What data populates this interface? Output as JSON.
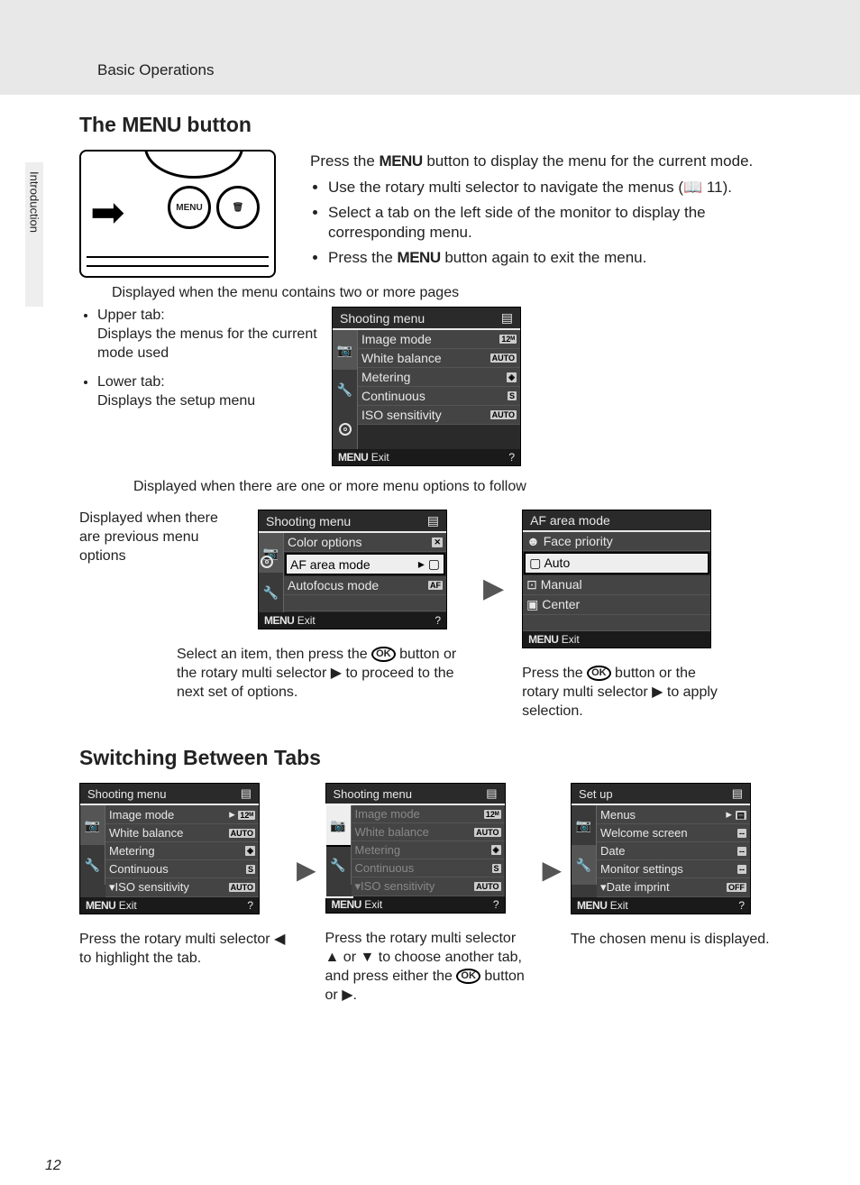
{
  "chapter": "Basic Operations",
  "side_tab": "Introduction",
  "page_number": "12",
  "h1_a": "The ",
  "h1_b": " button",
  "menu_word": "MENU",
  "camera": {
    "btn": "MENU",
    "trash": "🗑"
  },
  "intro": {
    "p1a": "Press the ",
    "p1b": " button to display the menu for the current mode.",
    "b1a": "Use the rotary multi selector to navigate the menus (",
    "b1_ref": "📖 11",
    "b1b": ").",
    "b2": "Select a tab on the left side of the monitor to display the corresponding menu.",
    "b3a": "Press the ",
    "b3b": " button again to exit the menu."
  },
  "note_above": "Displayed when the menu contains two or more pages",
  "tab_desc": {
    "u1": "Upper tab:",
    "u2": "Displays the menus for the current mode used",
    "l1": "Lower tab:",
    "l2": "Displays the setup menu"
  },
  "menu1": {
    "title": "Shooting menu",
    "items": [
      "Image mode",
      "White balance",
      "Metering",
      "Continuous",
      "ISO sensitivity"
    ],
    "exit": "Exit",
    "menu_label": "MENU",
    "pills": [
      "12ᴹ",
      "AUTO",
      "◈",
      "S",
      "AUTO"
    ]
  },
  "note_below": "Displayed when there are one or more menu options to follow",
  "col_a": "Displayed when there are previous menu options",
  "menu2": {
    "title": "Shooting menu",
    "items": [
      "Color options",
      "AF area mode",
      "Autofocus mode"
    ],
    "exit": "Exit",
    "menu_label": "MENU"
  },
  "cap2a": "Select an item, then press the ",
  "cap2b": " button or the rotary multi selector ▶ to proceed to the next set of options.",
  "menu3": {
    "title": "AF area mode",
    "items": [
      "Face priority",
      "Auto",
      "Manual",
      "Center"
    ],
    "exit": "Exit",
    "menu_label": "MENU"
  },
  "cap3a": "Press the ",
  "cap3b": " button or the rotary multi selector ▶ to apply selection.",
  "ok_label": "OK",
  "h2": "Switching Between Tabs",
  "sw1": {
    "title": "Shooting menu",
    "items": [
      "Image mode",
      "White balance",
      "Metering",
      "Continuous",
      "ISO sensitivity"
    ],
    "exit": "Exit",
    "menu_label": "MENU",
    "cap": "Press the rotary multi selector ◀ to highlight the tab."
  },
  "sw2": {
    "title": "Shooting menu",
    "items": [
      "Image mode",
      "White balance",
      "Metering",
      "Continuous",
      "ISO sensitivity"
    ],
    "exit": "Exit",
    "menu_label": "MENU",
    "cap_a": "Press the rotary multi selector ▲ or ▼ to choose another tab, and press either the ",
    "cap_b": " button or ▶."
  },
  "sw3": {
    "title": "Set up",
    "items": [
      "Menus",
      "Welcome screen",
      "Date",
      "Monitor settings",
      "Date imprint"
    ],
    "pills": [
      "▤",
      "--",
      "--",
      "--",
      "OFF"
    ],
    "exit": "Exit",
    "menu_label": "MENU",
    "cap": "The chosen menu is displayed."
  }
}
